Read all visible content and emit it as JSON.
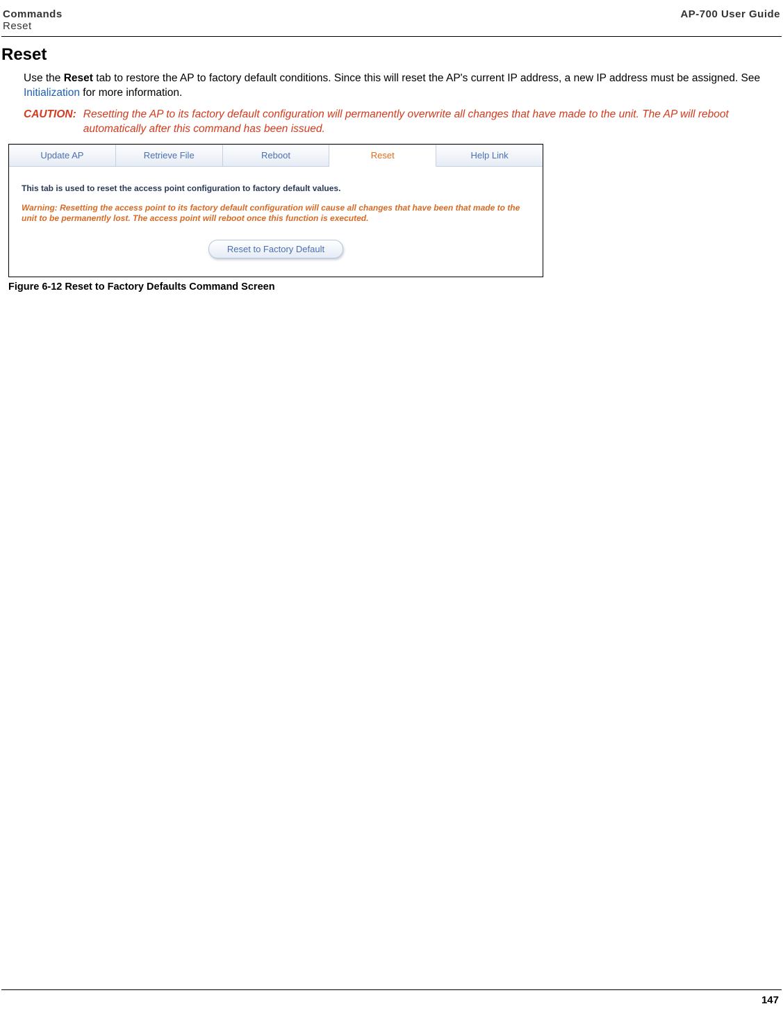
{
  "header": {
    "section": "Commands",
    "subsection": "Reset",
    "guide": "AP-700 User Guide"
  },
  "title": "Reset",
  "intro": {
    "pre": "Use the ",
    "bold": "Reset",
    "mid": " tab to restore the AP to factory default conditions. Since this will reset the AP's current IP address, a new IP address must be assigned. See ",
    "link": "Initialization",
    "post": " for more information."
  },
  "caution": {
    "label": "CAUTION:",
    "text": "Resetting the AP to its factory default configuration will permanently overwrite all changes that have made to the unit. The AP will reboot automatically after this command has been issued."
  },
  "screenshot": {
    "tabs": {
      "update": "Update AP",
      "retrieve": "Retrieve File",
      "reboot": "Reboot",
      "reset": "Reset",
      "help": "Help Link"
    },
    "desc": "This tab is used to reset the access point configuration to factory default values.",
    "warning": "Warning: Resetting the access point to its factory default configuration will cause all changes that have been that made to the unit to be permanently lost. The access point will reboot once this function is executed.",
    "button": "Reset to Factory Default"
  },
  "figure_caption": "Figure 6-12 Reset to Factory Defaults Command Screen",
  "page_number": "147"
}
